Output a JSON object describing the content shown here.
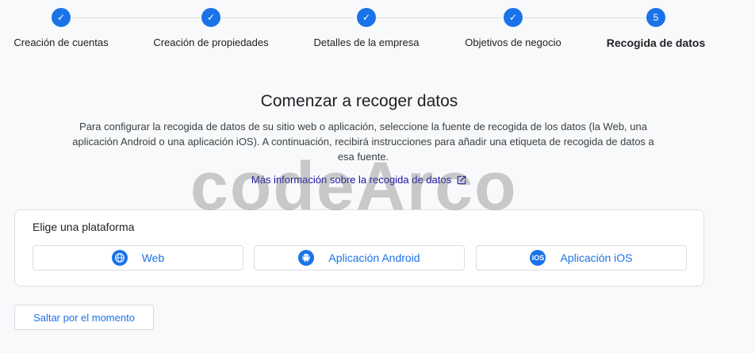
{
  "stepper": {
    "steps": [
      {
        "label": "Creación de cuentas",
        "state": "done",
        "marker": "✓"
      },
      {
        "label": "Creación de propiedades",
        "state": "done",
        "marker": "✓"
      },
      {
        "label": "Detalles de la empresa",
        "state": "done",
        "marker": "✓"
      },
      {
        "label": "Objetivos de negocio",
        "state": "done",
        "marker": "✓"
      },
      {
        "label": "Recogida de datos",
        "state": "active",
        "marker": "5"
      }
    ]
  },
  "main": {
    "title": "Comenzar a recoger datos",
    "description": "Para configurar la recogida de datos de su sitio web o aplicación, seleccione la fuente de recogida de los datos (la Web, una aplicación Android o una aplicación iOS). A continuación, recibirá instrucciones para añadir una etiqueta de recogida de datos a esa fuente.",
    "more_link": "Más información sobre la recogida de datos"
  },
  "platform_card": {
    "label": "Elige una plataforma",
    "buttons": [
      {
        "label": "Web",
        "icon": "globe-icon"
      },
      {
        "label": "Aplicación Android",
        "icon": "android-icon"
      },
      {
        "label": "Aplicación iOS",
        "icon": "ios-icon",
        "icon_text": "iOS"
      }
    ]
  },
  "skip_label": "Saltar por el momento",
  "watermark": "codeArco",
  "colors": {
    "accent": "#1a73e8",
    "link": "#1a0dab",
    "background": "#f8f9fa"
  }
}
